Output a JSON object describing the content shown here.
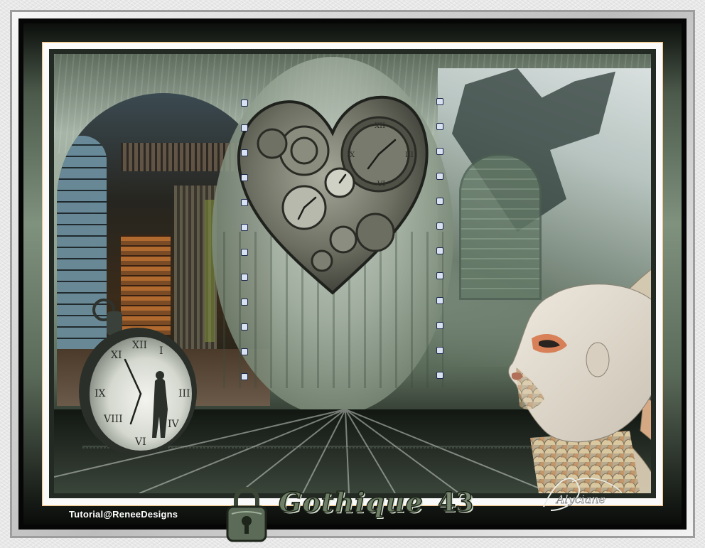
{
  "footer": {
    "credit": "Tutorial@ReneeDesigns",
    "title_word": "Gothique",
    "title_number": "43"
  },
  "signature": {
    "text": "Alyciane"
  },
  "colors": {
    "frame_dark": "#050605",
    "frame_green": "#7f927e",
    "frame_gold": "#f0c07a",
    "scene_mid": "#a6b5a7",
    "accent_copper": "#d98a4a"
  }
}
